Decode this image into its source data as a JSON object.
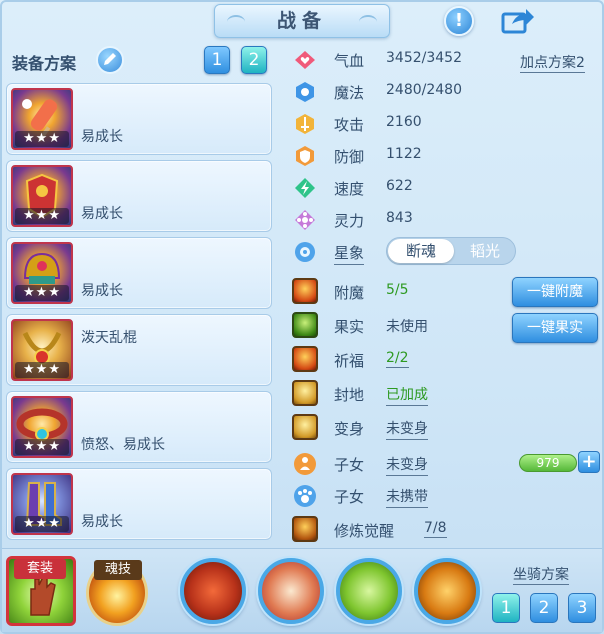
{
  "header": {
    "title": "战备",
    "help_glyph": "!",
    "share_icon": "share-icon"
  },
  "equip": {
    "label": "装备方案",
    "plan_buttons": [
      "1",
      "2"
    ],
    "active_plan": "2",
    "slots": [
      {
        "text": "易成长",
        "stars": "★★★",
        "icon": "ice-pop-icon"
      },
      {
        "text": "易成长",
        "stars": "★★★",
        "icon": "armor-icon"
      },
      {
        "text": "易成长",
        "stars": "★★★",
        "icon": "helmet-icon"
      },
      {
        "text": "泼天乱棍",
        "stars": "★★★",
        "icon": "necklace-icon"
      },
      {
        "text": "愤怒、易成长",
        "stars": "★★★",
        "icon": "belt-icon"
      },
      {
        "text": "易成长",
        "stars": "★★★",
        "icon": "boots-icon"
      }
    ]
  },
  "stats": {
    "plan_link": "加点方案2",
    "hp": {
      "name": "气血",
      "value": "3452/3452"
    },
    "mp": {
      "name": "魔法",
      "value": "2480/2480"
    },
    "atk": {
      "name": "攻击",
      "value": "2160"
    },
    "def": {
      "name": "防御",
      "value": "1122"
    },
    "spd": {
      "name": "速度",
      "value": "622"
    },
    "spi": {
      "name": "灵力",
      "value": "843"
    },
    "star": {
      "name": "星象",
      "option_on": "断魂",
      "option_off": "韬光"
    }
  },
  "extras": {
    "enchant": {
      "name": "附魔",
      "value": "5/5",
      "button": "一键附魔"
    },
    "fruit": {
      "name": "果实",
      "value": "未使用",
      "button": "一键果实"
    },
    "bless": {
      "name": "祈福",
      "value": "2/2"
    },
    "seal": {
      "name": "封地",
      "value": "已加成"
    },
    "transform": {
      "name": "变身",
      "value": "未变身"
    },
    "child1": {
      "name": "子女",
      "value": "未变身",
      "count": "979",
      "plus": "+"
    },
    "child2": {
      "name": "子女",
      "value": "未携带"
    },
    "cultivate": {
      "name": "修炼觉醒",
      "value": "7/8"
    }
  },
  "bottom": {
    "set_label": "套装",
    "soul_label": "魂技",
    "skills": [
      "beast-skill-icon",
      "blade-skill-icon",
      "sword-skill-icon",
      "dash-skill-icon"
    ],
    "mount_label": "坐骑方案",
    "mount_buttons": [
      "1",
      "2",
      "3"
    ],
    "active_mount": "1"
  },
  "colors": {
    "accent": "#2f8ee0",
    "active": "#1fb3c2",
    "green_value": "#2e9a22",
    "rare_border": "#c0354c"
  }
}
